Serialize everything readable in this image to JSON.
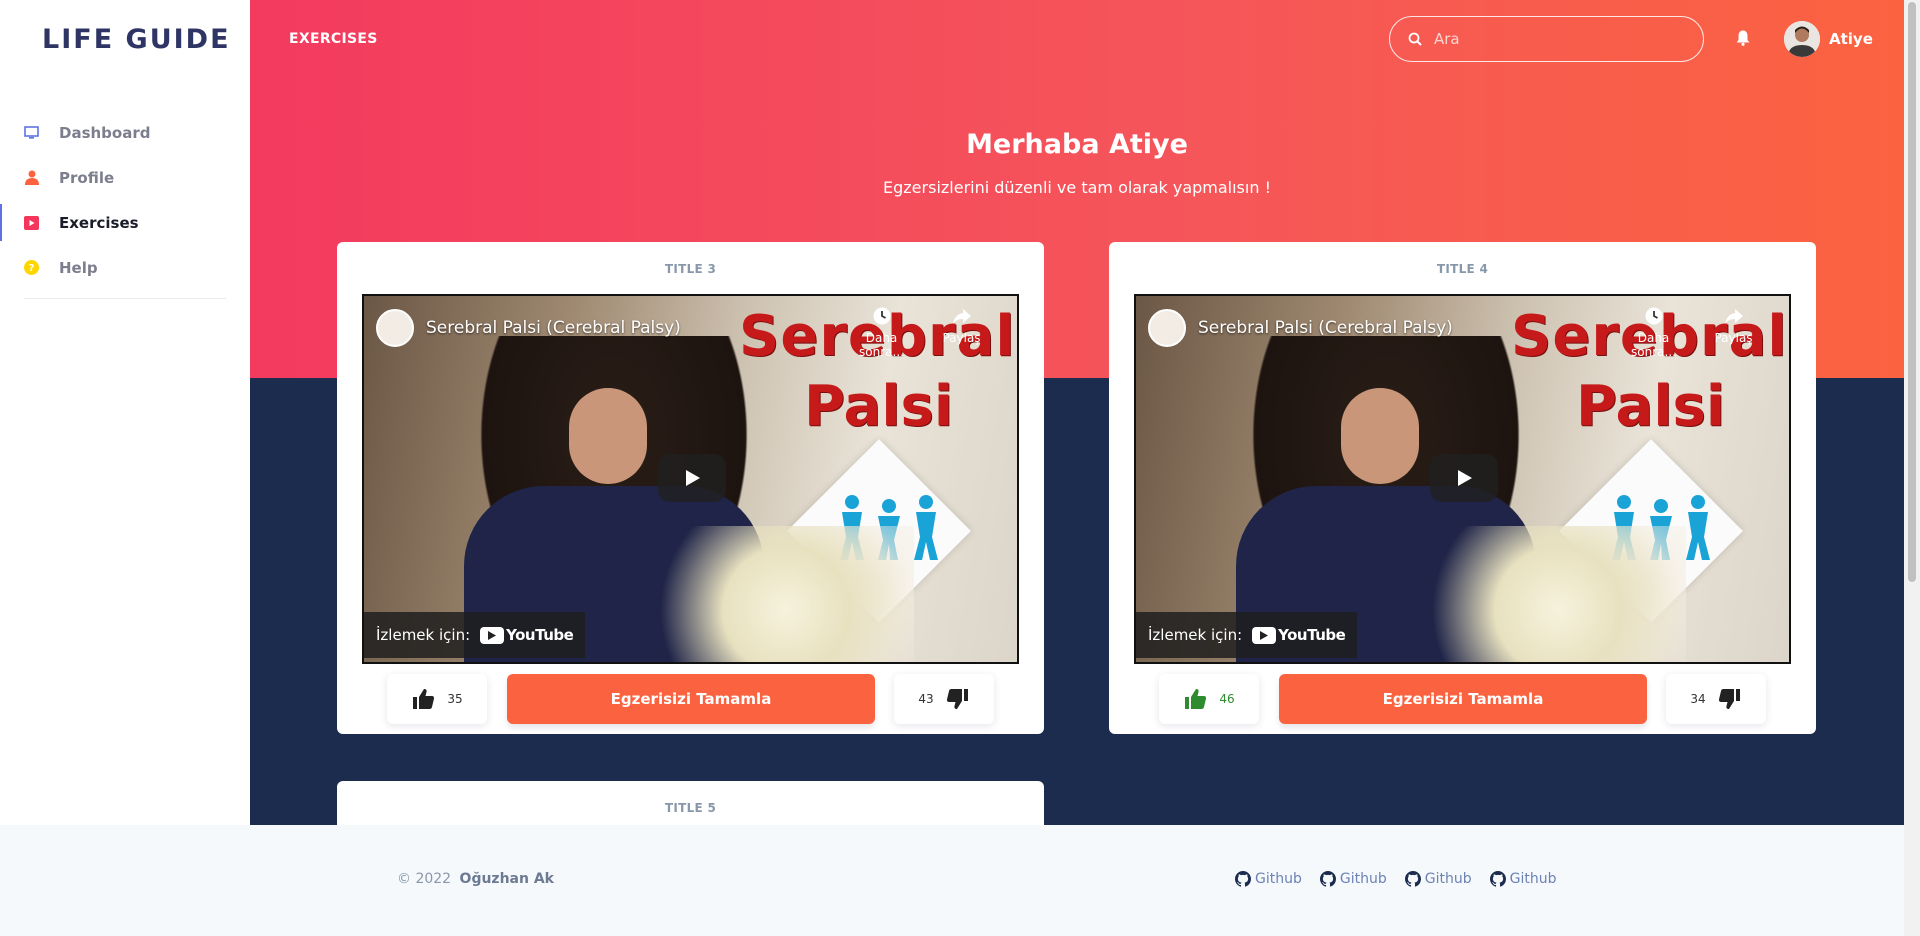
{
  "brand": "LIFE GUIDE",
  "sidebar": {
    "items": [
      {
        "label": "Dashboard",
        "icon": "monitor-icon",
        "color": "#5e72e4"
      },
      {
        "label": "Profile",
        "icon": "user-icon",
        "color": "#fb6340"
      },
      {
        "label": "Exercises",
        "icon": "play-square-icon",
        "color": "#f5365c",
        "active": true
      },
      {
        "label": "Help",
        "icon": "help-circle-icon",
        "color": "#ffd600"
      }
    ]
  },
  "topbar": {
    "page_title": "EXERCISES",
    "search_placeholder": "Ara",
    "user_name": "Atiye"
  },
  "hero": {
    "greeting": "Merhaba Atiye",
    "subtitle": "Egzersizlerini düzenli ve tam olarak yapmalısın !"
  },
  "cards": [
    {
      "title": "TITLE 3",
      "video": {
        "title": "Serebral Palsi (Cerebral Palsy)",
        "overlay_line1": "Serebral",
        "overlay_line2": "Palsi",
        "watch_later": "Daha sonra...",
        "share": "Paylaş",
        "watch_on": "İzlemek için:",
        "youtube": "YouTube"
      },
      "likes": "35",
      "dislikes": "43",
      "liked": false,
      "complete_label": "Egzerisizi Tamamla"
    },
    {
      "title": "TITLE 4",
      "video": {
        "title": "Serebral Palsi (Cerebral Palsy)",
        "overlay_line1": "Serebral",
        "overlay_line2": "Palsi",
        "watch_later": "Daha sonra...",
        "share": "Paylaş",
        "watch_on": "İzlemek için:",
        "youtube": "YouTube"
      },
      "likes": "46",
      "dislikes": "34",
      "liked": true,
      "complete_label": "Egzerisizi Tamamla"
    },
    {
      "title": "TITLE 5"
    }
  ],
  "footer": {
    "copyright": "© 2022",
    "author": "Oğuzhan Ak",
    "links": [
      "Github",
      "Github",
      "Github",
      "Github"
    ]
  },
  "colors": {
    "hero_gradient_start": "#f33a5f",
    "hero_gradient_end": "#fb6340",
    "dark_bg": "#1c2c4e",
    "accent_button": "#fb6340",
    "like_active": "#2e8b2e"
  }
}
